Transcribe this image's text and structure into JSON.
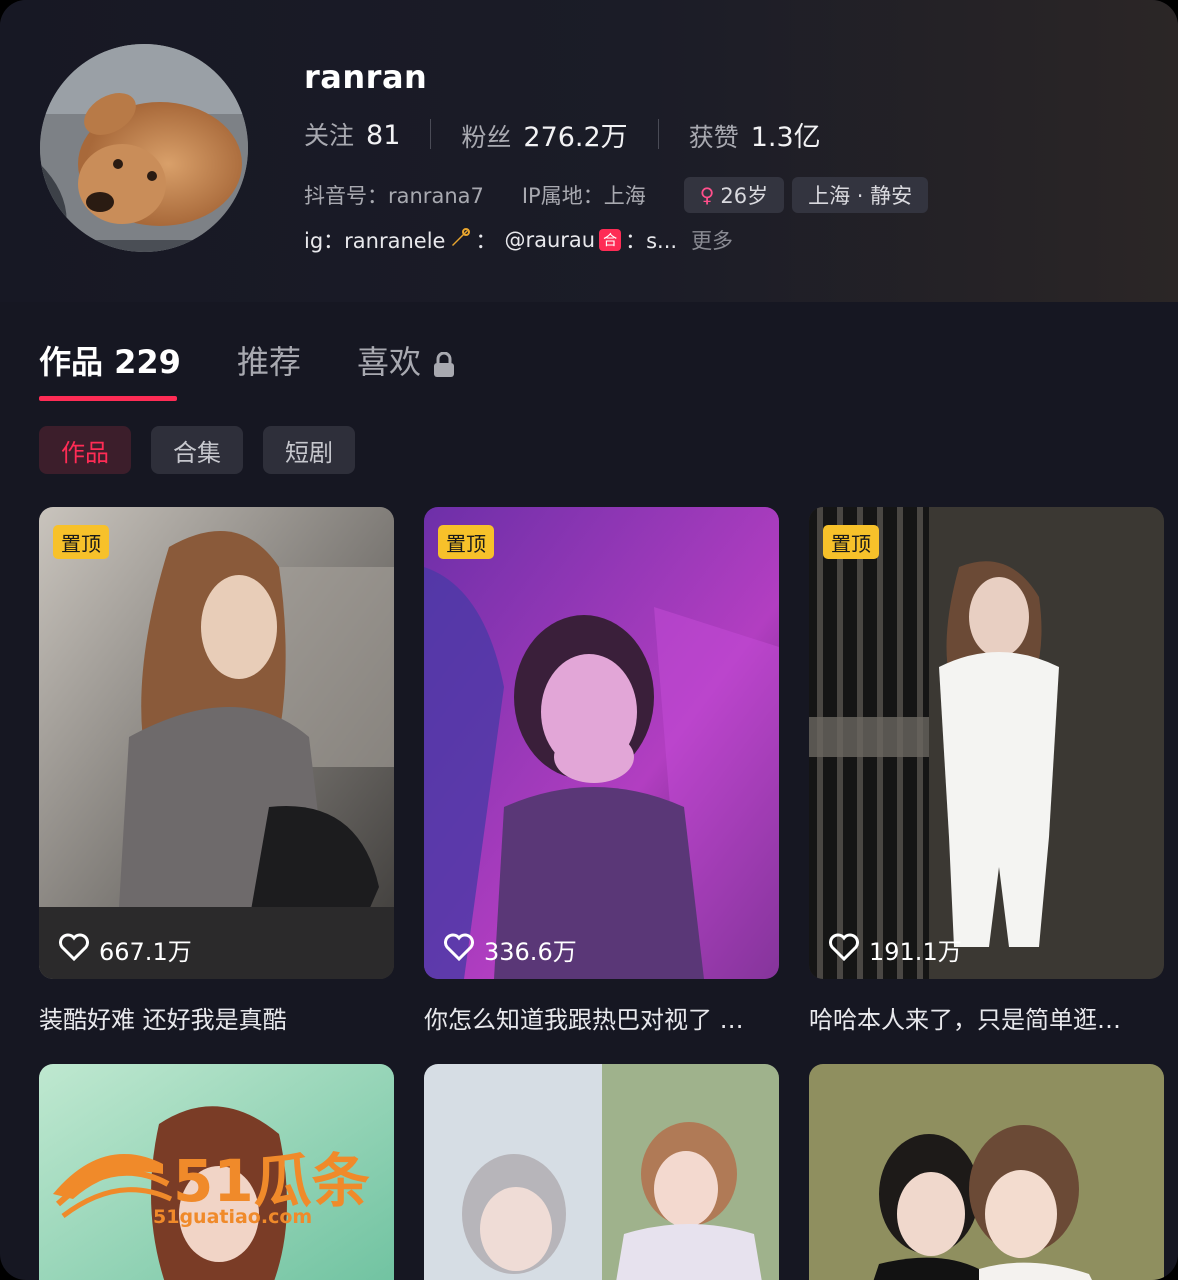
{
  "profile": {
    "name": "ranran",
    "following_label": "关注",
    "following_value": "81",
    "followers_label": "粉丝",
    "followers_value": "276.2万",
    "likes_label": "获赞",
    "likes_value": "1.3亿",
    "douyin_id": "抖音号：ranrana7",
    "ip_location": "IP属地：上海",
    "age": "26岁",
    "region": "上海 · 静安",
    "bio_ig": "ig：ranranele",
    "bio_colon1": "：",
    "bio_handle": "@raurau",
    "bio_badge": "合",
    "bio_tail": "：s...",
    "bio_more": "更多"
  },
  "tabs": [
    {
      "label": "作品 229"
    },
    {
      "label": "推荐"
    },
    {
      "label": "喜欢"
    }
  ],
  "chips": [
    "作品",
    "合集",
    "短剧"
  ],
  "videos": [
    {
      "pinned": "置顶",
      "likes": "667.1万",
      "caption": "装酷好难 还好我是真酷"
    },
    {
      "pinned": "置顶",
      "likes": "336.6万",
      "caption": "你怎么知道我跟热巴对视了 …"
    },
    {
      "pinned": "置顶",
      "likes": "191.1万",
      "caption": "哈哈本人来了，只是简单逛…"
    }
  ],
  "watermark": {
    "text": "51瓜条",
    "url": "51guatiao.com"
  },
  "colors": {
    "accent": "#fe2c55",
    "pin": "#f7c12a",
    "background": "#161722"
  }
}
